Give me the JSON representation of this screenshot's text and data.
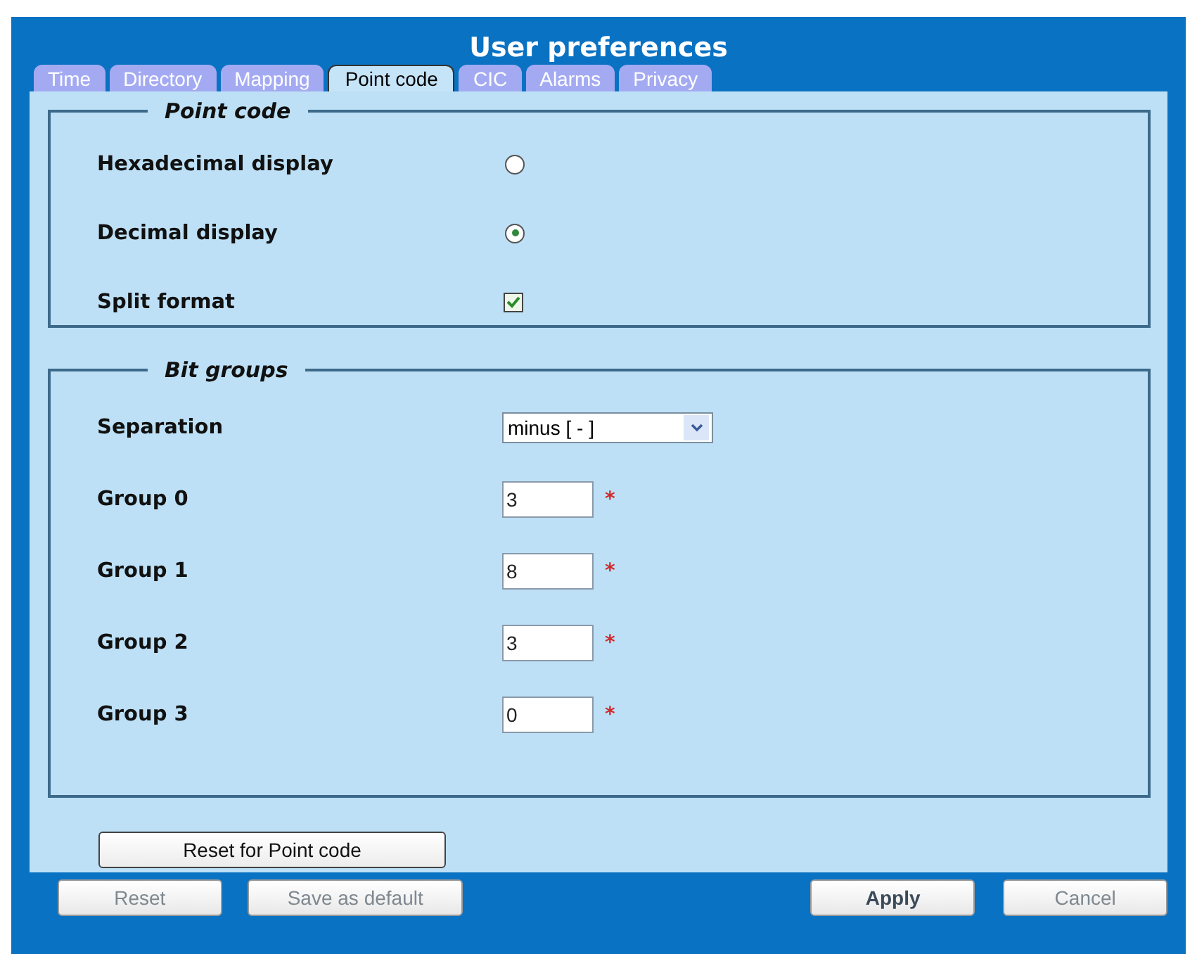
{
  "window": {
    "title": "User preferences"
  },
  "tabs": [
    {
      "label": "Time",
      "selected": false
    },
    {
      "label": "Directory",
      "selected": false
    },
    {
      "label": "Mapping",
      "selected": false
    },
    {
      "label": "Point code",
      "selected": true
    },
    {
      "label": "CIC",
      "selected": false
    },
    {
      "label": "Alarms",
      "selected": false
    },
    {
      "label": "Privacy",
      "selected": false
    }
  ],
  "sections": [
    {
      "legend": "Point code",
      "rows": [
        {
          "kind": "radio",
          "label": "Hexadecimal display",
          "selected": false
        },
        {
          "kind": "radio",
          "label": "Decimal display",
          "selected": true
        },
        {
          "kind": "checkbox",
          "label": "Split format",
          "checked": true
        }
      ]
    },
    {
      "legend": "Bit groups",
      "rows": [
        {
          "kind": "select",
          "label": "Separation",
          "value": "minus [ - ]"
        },
        {
          "kind": "input",
          "label": "Group 0",
          "value": "3",
          "required_mark": "*"
        },
        {
          "kind": "input",
          "label": "Group 1",
          "value": "8",
          "required_mark": "*"
        },
        {
          "kind": "input",
          "label": "Group 2",
          "value": "3",
          "required_mark": "*"
        },
        {
          "kind": "input",
          "label": "Group 3",
          "value": "0",
          "required_mark": "*"
        }
      ]
    }
  ],
  "section_button": "Reset for Point code",
  "footer_buttons": [
    {
      "label": "Reset",
      "disabled": true
    },
    {
      "label": "Save as default",
      "disabled": true
    },
    {
      "label": "Apply",
      "disabled": false
    },
    {
      "label": "Cancel",
      "disabled": true
    }
  ]
}
